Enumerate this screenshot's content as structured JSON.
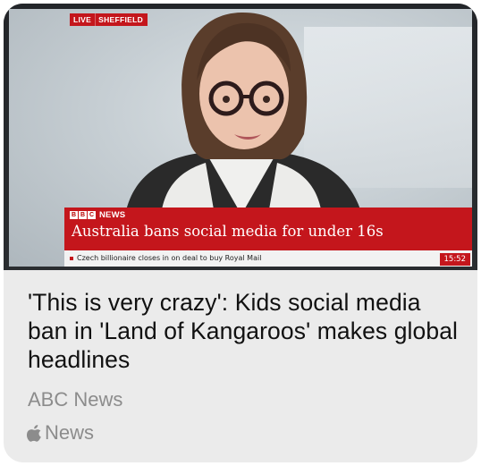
{
  "article": {
    "title": "'This is very crazy': Kids social media ban in 'Land of Kangaroos' makes global headlines",
    "publisher": "ABC News",
    "source_label": "News",
    "source_icon": "apple-icon"
  },
  "broadcast": {
    "live_label": "LIVE",
    "location": "SHEFFIELD",
    "brand_blocks": [
      "B",
      "B",
      "C"
    ],
    "brand_label": "NEWS",
    "headline": "Australia bans social media for under 16s",
    "ticker": "Czech billionaire closes in on deal to buy Royal Mail",
    "time": "15:52"
  },
  "colors": {
    "bbc_red": "#c4161c",
    "card_background": "#ebebeb",
    "secondary_text": "#8c8c8c"
  }
}
